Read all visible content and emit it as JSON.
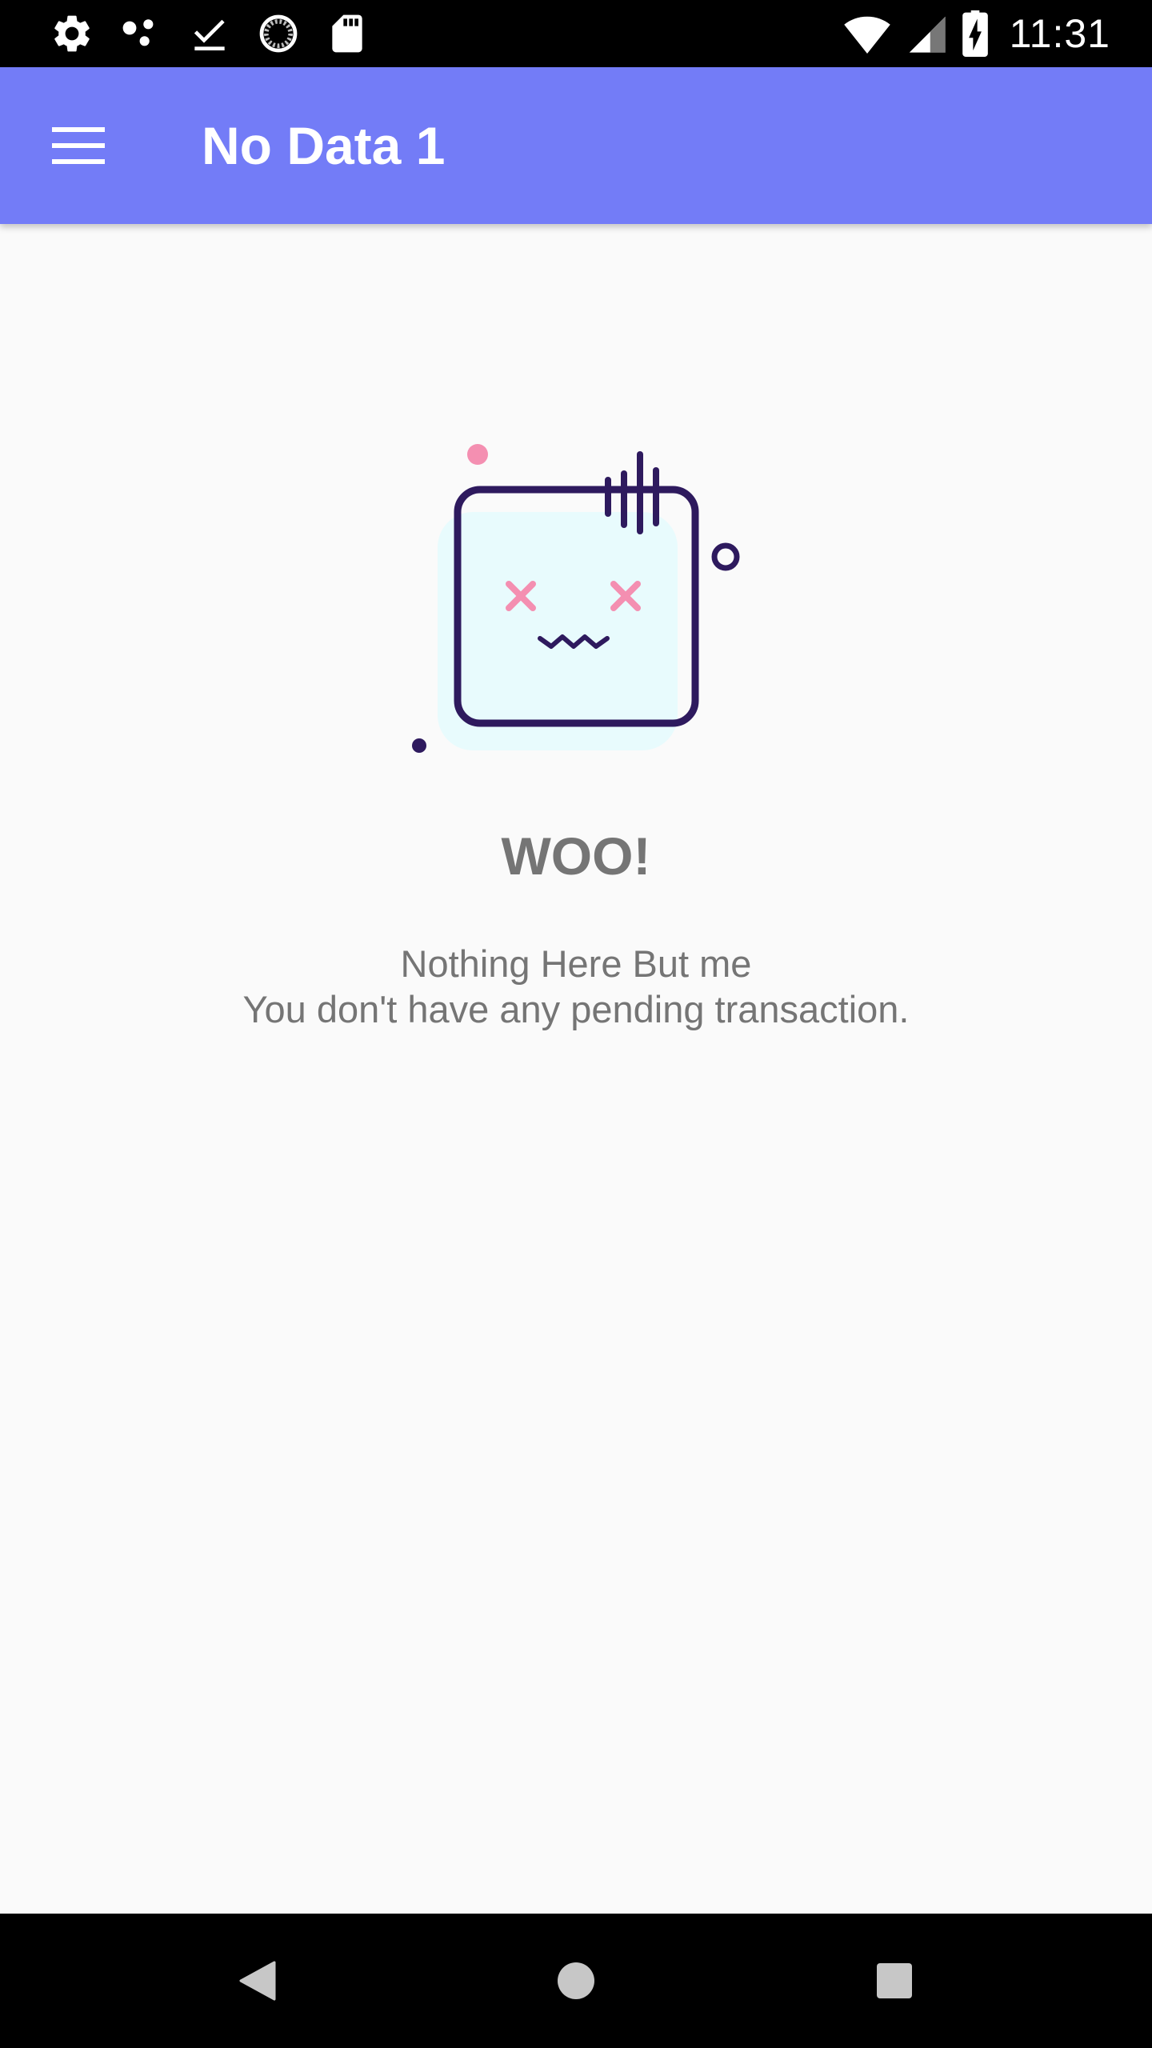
{
  "status_bar": {
    "time": "11:31",
    "icons_left": [
      "settings-icon",
      "dots-icon",
      "download-done-icon",
      "sync-icon",
      "sd-card-icon"
    ],
    "icons_right": [
      "wifi-icon",
      "cellular-signal-icon",
      "battery-charging-icon"
    ]
  },
  "app_bar": {
    "title": "No Data 1",
    "menu_icon": "hamburger-menu-icon",
    "background": "#737cf7"
  },
  "empty_state": {
    "illustration": "dizzy-box-face",
    "title": "WOO!",
    "message_line1": "Nothing Here But me",
    "message_line2": "You don't have any pending transaction.",
    "colors": {
      "outline": "#2e1a5e",
      "accent": "#f48fb1",
      "fill": "#e8fbfd",
      "text": "#757575"
    }
  },
  "nav_bar": {
    "buttons": [
      "back-icon",
      "home-icon",
      "recents-icon"
    ]
  }
}
